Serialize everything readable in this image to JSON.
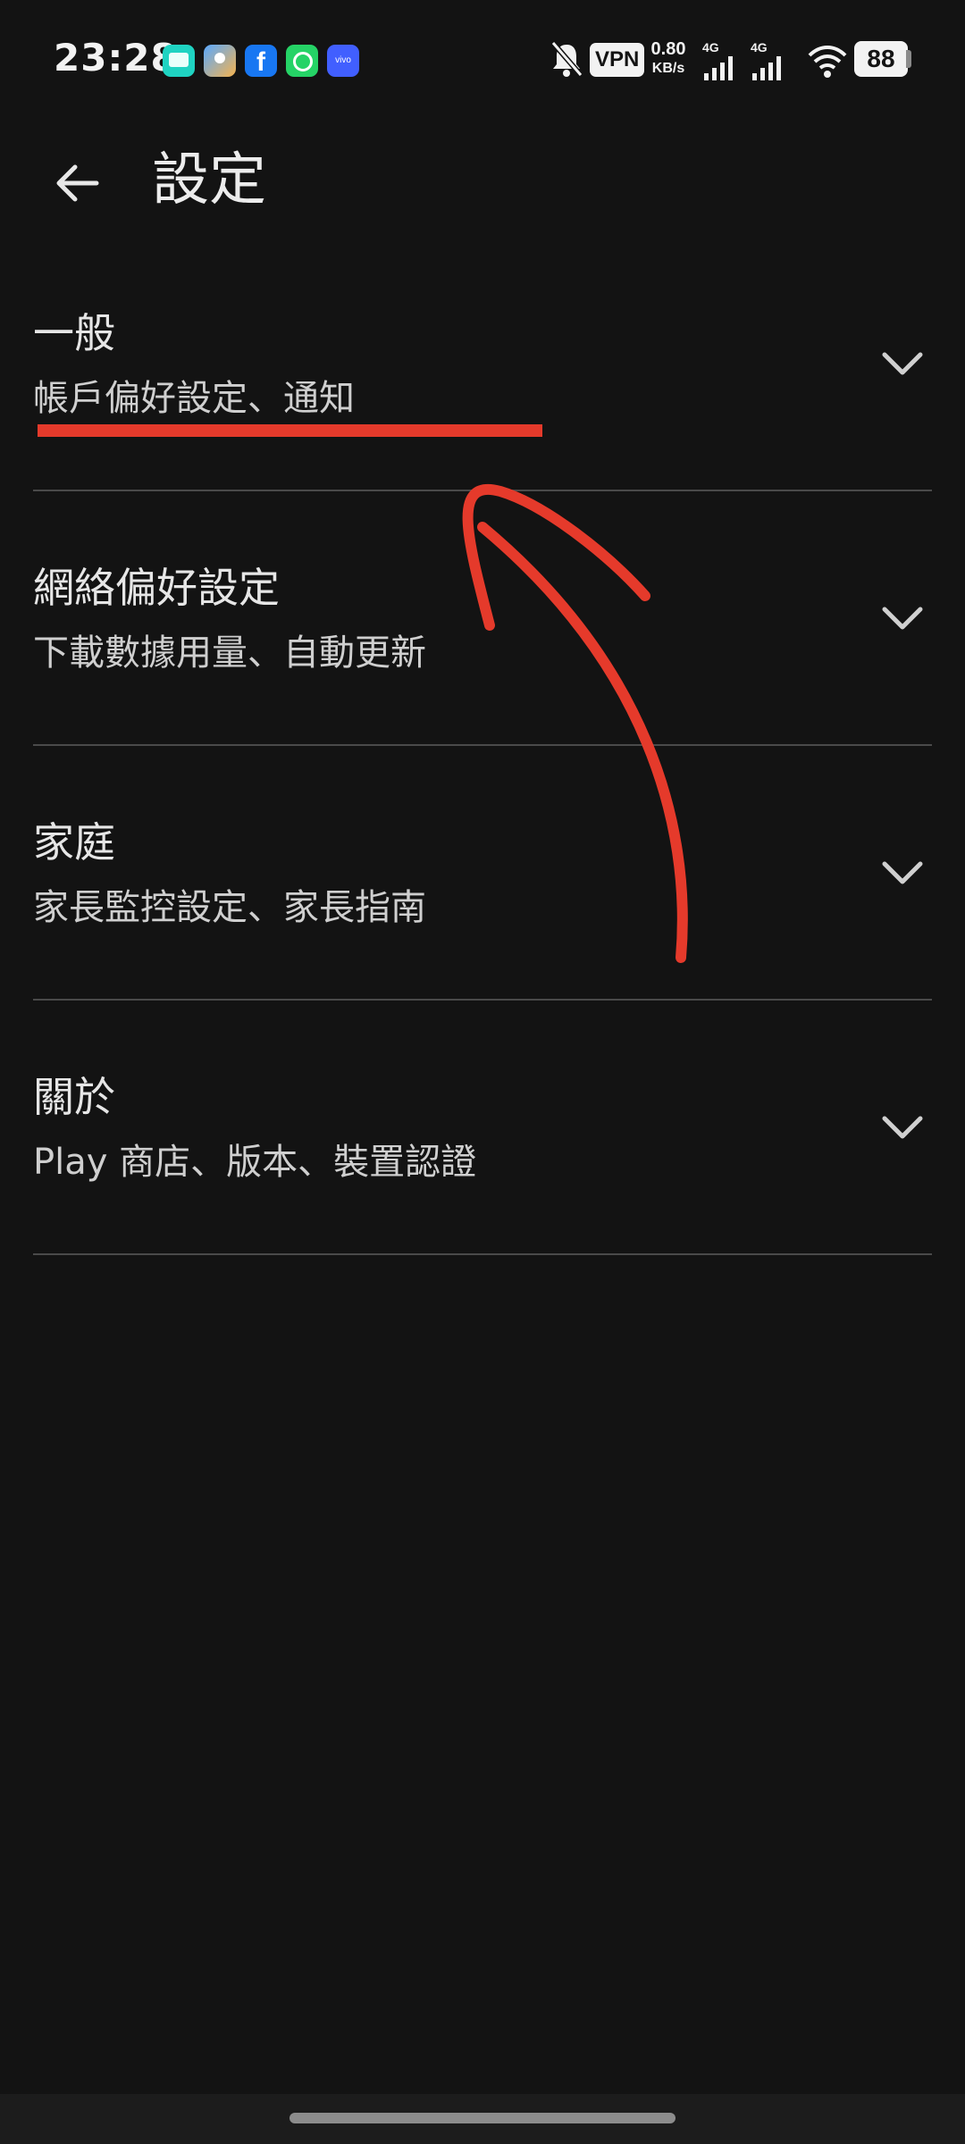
{
  "status_bar": {
    "time": "23:28",
    "notification_icons": [
      "messages-icon",
      "gallery-icon",
      "facebook-icon",
      "whatsapp-icon",
      "vivo-icon"
    ],
    "facebook_glyph": "f",
    "vivo_label": "vivo",
    "vpn_label": "VPN",
    "net_speed_value": "0.80",
    "net_speed_unit": "KB/s",
    "network_label_1": "4G",
    "network_label_2": "4G",
    "battery_level": "88"
  },
  "header": {
    "back_icon": "arrow-left-icon",
    "title": "設定"
  },
  "sections": [
    {
      "title": "一般",
      "subtitle": "帳戶偏好設定、通知",
      "icon": "chevron-down-icon"
    },
    {
      "title": "網絡偏好設定",
      "subtitle": "下載數據用量、自動更新",
      "icon": "chevron-down-icon"
    },
    {
      "title": "家庭",
      "subtitle": "家長監控設定、家長指南",
      "icon": "chevron-down-icon"
    },
    {
      "title": "關於",
      "subtitle": "Play 商店、版本、裝置認證",
      "icon": "chevron-down-icon"
    }
  ],
  "colors": {
    "background": "#131313",
    "annotation": "#e53a2b",
    "divider": "#4a4a4a"
  }
}
